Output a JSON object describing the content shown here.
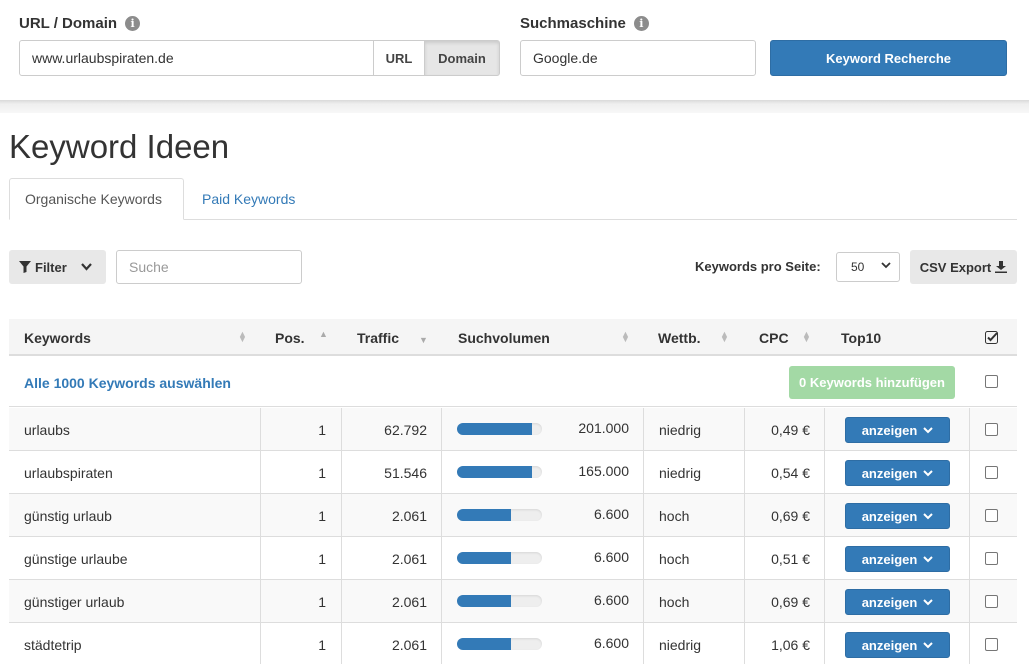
{
  "form": {
    "url_label": "URL / Domain",
    "url_value": "www.urlaubspiraten.de",
    "seg_url": "URL",
    "seg_domain": "Domain",
    "engine_label": "Suchmaschine",
    "engine_value": "Google.de",
    "submit_label": "Keyword Recherche"
  },
  "page": {
    "title": "Keyword Ideen"
  },
  "tabs": [
    {
      "label": "Organische Keywords",
      "active": true
    },
    {
      "label": "Paid Keywords",
      "active": false
    }
  ],
  "toolbar": {
    "filter_label": "Filter",
    "search_placeholder": "Suche",
    "kps_label": "Keywords pro Seite:",
    "kps_value": "50",
    "csv_label": "CSV Export"
  },
  "table": {
    "columns": {
      "keywords": "Keywords",
      "pos": "Pos.",
      "traffic": "Traffic",
      "volume": "Suchvolumen",
      "comp": "Wettb.",
      "cpc": "CPC",
      "top10": "Top10"
    },
    "select_all": "Alle 1000 Keywords auswählen",
    "add_label": "0 Keywords hinzufügen",
    "show_label": "anzeigen",
    "rows": [
      {
        "keyword": "urlaubs",
        "pos": "1",
        "traffic": "62.792",
        "volume": "201.000",
        "bar": 0.88,
        "comp": "niedrig",
        "cpc": "0,49 €"
      },
      {
        "keyword": "urlaubspiraten",
        "pos": "1",
        "traffic": "51.546",
        "volume": "165.000",
        "bar": 0.88,
        "comp": "niedrig",
        "cpc": "0,54 €"
      },
      {
        "keyword": "günstig urlaub",
        "pos": "1",
        "traffic": "2.061",
        "volume": "6.600",
        "bar": 0.63,
        "comp": "hoch",
        "cpc": "0,69 €"
      },
      {
        "keyword": "günstige urlaube",
        "pos": "1",
        "traffic": "2.061",
        "volume": "6.600",
        "bar": 0.63,
        "comp": "hoch",
        "cpc": "0,51 €"
      },
      {
        "keyword": "günstiger urlaub",
        "pos": "1",
        "traffic": "2.061",
        "volume": "6.600",
        "bar": 0.63,
        "comp": "hoch",
        "cpc": "0,69 €"
      },
      {
        "keyword": "städtetrip",
        "pos": "1",
        "traffic": "2.061",
        "volume": "6.600",
        "bar": 0.63,
        "comp": "niedrig",
        "cpc": "1,06 €"
      }
    ]
  },
  "colors": {
    "primary": "#337ab7",
    "success_disabled": "#a3d9a5"
  }
}
